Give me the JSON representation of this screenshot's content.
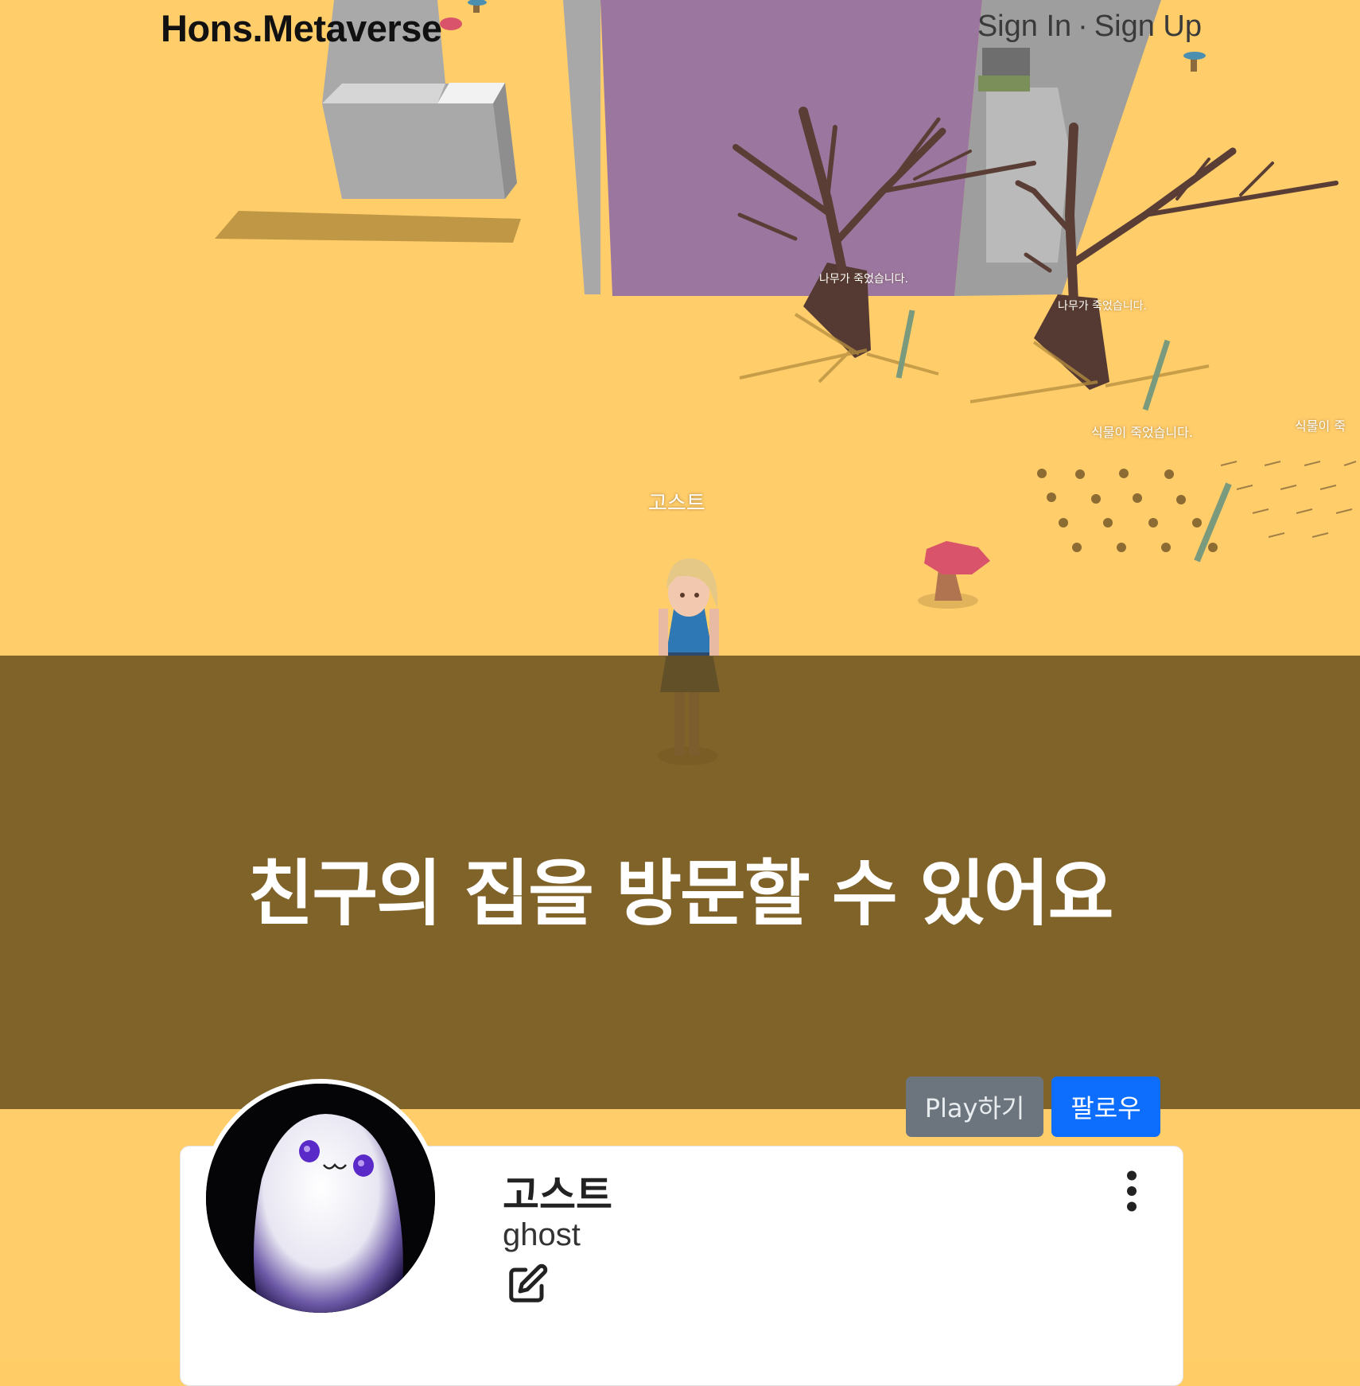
{
  "header": {
    "brand": "Hons.Metaverse",
    "sign_in": "Sign In",
    "separator": "·",
    "sign_up": "Sign Up"
  },
  "scene": {
    "player_label": "고스트",
    "tree_label_1": "나무가 죽었습니다.",
    "tree_label_2": "나무가 죽었습니다.",
    "plant_label_1": "식물이 죽었습니다.",
    "plant_label_2": "식물이 죽"
  },
  "banner": {
    "headline": "친구의 집을 방문할 수 있어요"
  },
  "actions": {
    "play_label": "Play하기",
    "follow_label": "팔로우"
  },
  "profile": {
    "display_name": "고스트",
    "username": "ghost",
    "icons": [
      "edit-icon",
      "more-vertical-icon"
    ]
  },
  "colors": {
    "ground": "#FFCD6A",
    "banner_overlay": "#6B521E",
    "play_button": "#6C757D",
    "follow_button": "#0D6EFD",
    "wall_purple": "#9B77A0"
  }
}
